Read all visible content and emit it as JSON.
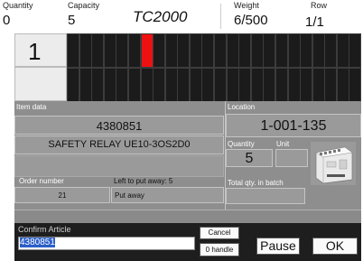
{
  "header": {
    "quantity_label": "Quantity",
    "quantity_value": "0",
    "capacity_label": "Capacity",
    "capacity_value": "5",
    "model": "TC2000",
    "weight_label": "Weight",
    "weight_value": "6/500",
    "row_label": "Row",
    "row_value": "1/1"
  },
  "grid": {
    "row_number": "1",
    "columns": 24,
    "rows": 2,
    "highlighted_cell": {
      "row": 1,
      "col": 7
    },
    "highlight_color": "#ee1111"
  },
  "item": {
    "section_label": "Item data",
    "number": "4380851",
    "description": "SAFETY RELAY UE10-3OS2D0",
    "order_number_label": "Order number",
    "order_number": "21",
    "left_to_put_away": "Left to put away: 5",
    "status": "Put away"
  },
  "location": {
    "section_label": "Location",
    "code": "1-001-135",
    "quantity_label": "Quantity",
    "quantity_value": "5",
    "unit_label": "Unit",
    "unit_value": "",
    "total_label": "Total qty. in batch"
  },
  "confirm": {
    "label": "Confirm Article",
    "input_value": "4380851",
    "cancel_label": "Cancel",
    "handle_label": "0 handle",
    "pause_label": "Pause",
    "ok_label": "OK"
  }
}
